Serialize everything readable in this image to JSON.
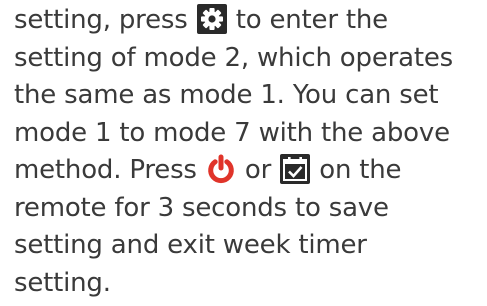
{
  "manual": {
    "line1_before_icon": "setting, press ",
    "line1_after_icon": " to enter the",
    "line2": "setting of mode 2, which operates",
    "line3": "the same as mode 1. You can set",
    "line4": "mode 1 to mode 7 with the above",
    "line5_before_power": "method. Press ",
    "line5_or": " or ",
    "line5_after_timer": " on the",
    "line6": "remote for 3 seconds to save",
    "line7": "setting and exit week timer",
    "line8": "setting."
  },
  "icons": {
    "settings": "gear-icon",
    "power": "power-icon",
    "timer": "calendar-check-icon"
  },
  "colors": {
    "text": "#3a3a3a",
    "gear_bg": "#2a2a2a",
    "power": "#e0342a",
    "timer_bg": "#2a2a2a"
  }
}
